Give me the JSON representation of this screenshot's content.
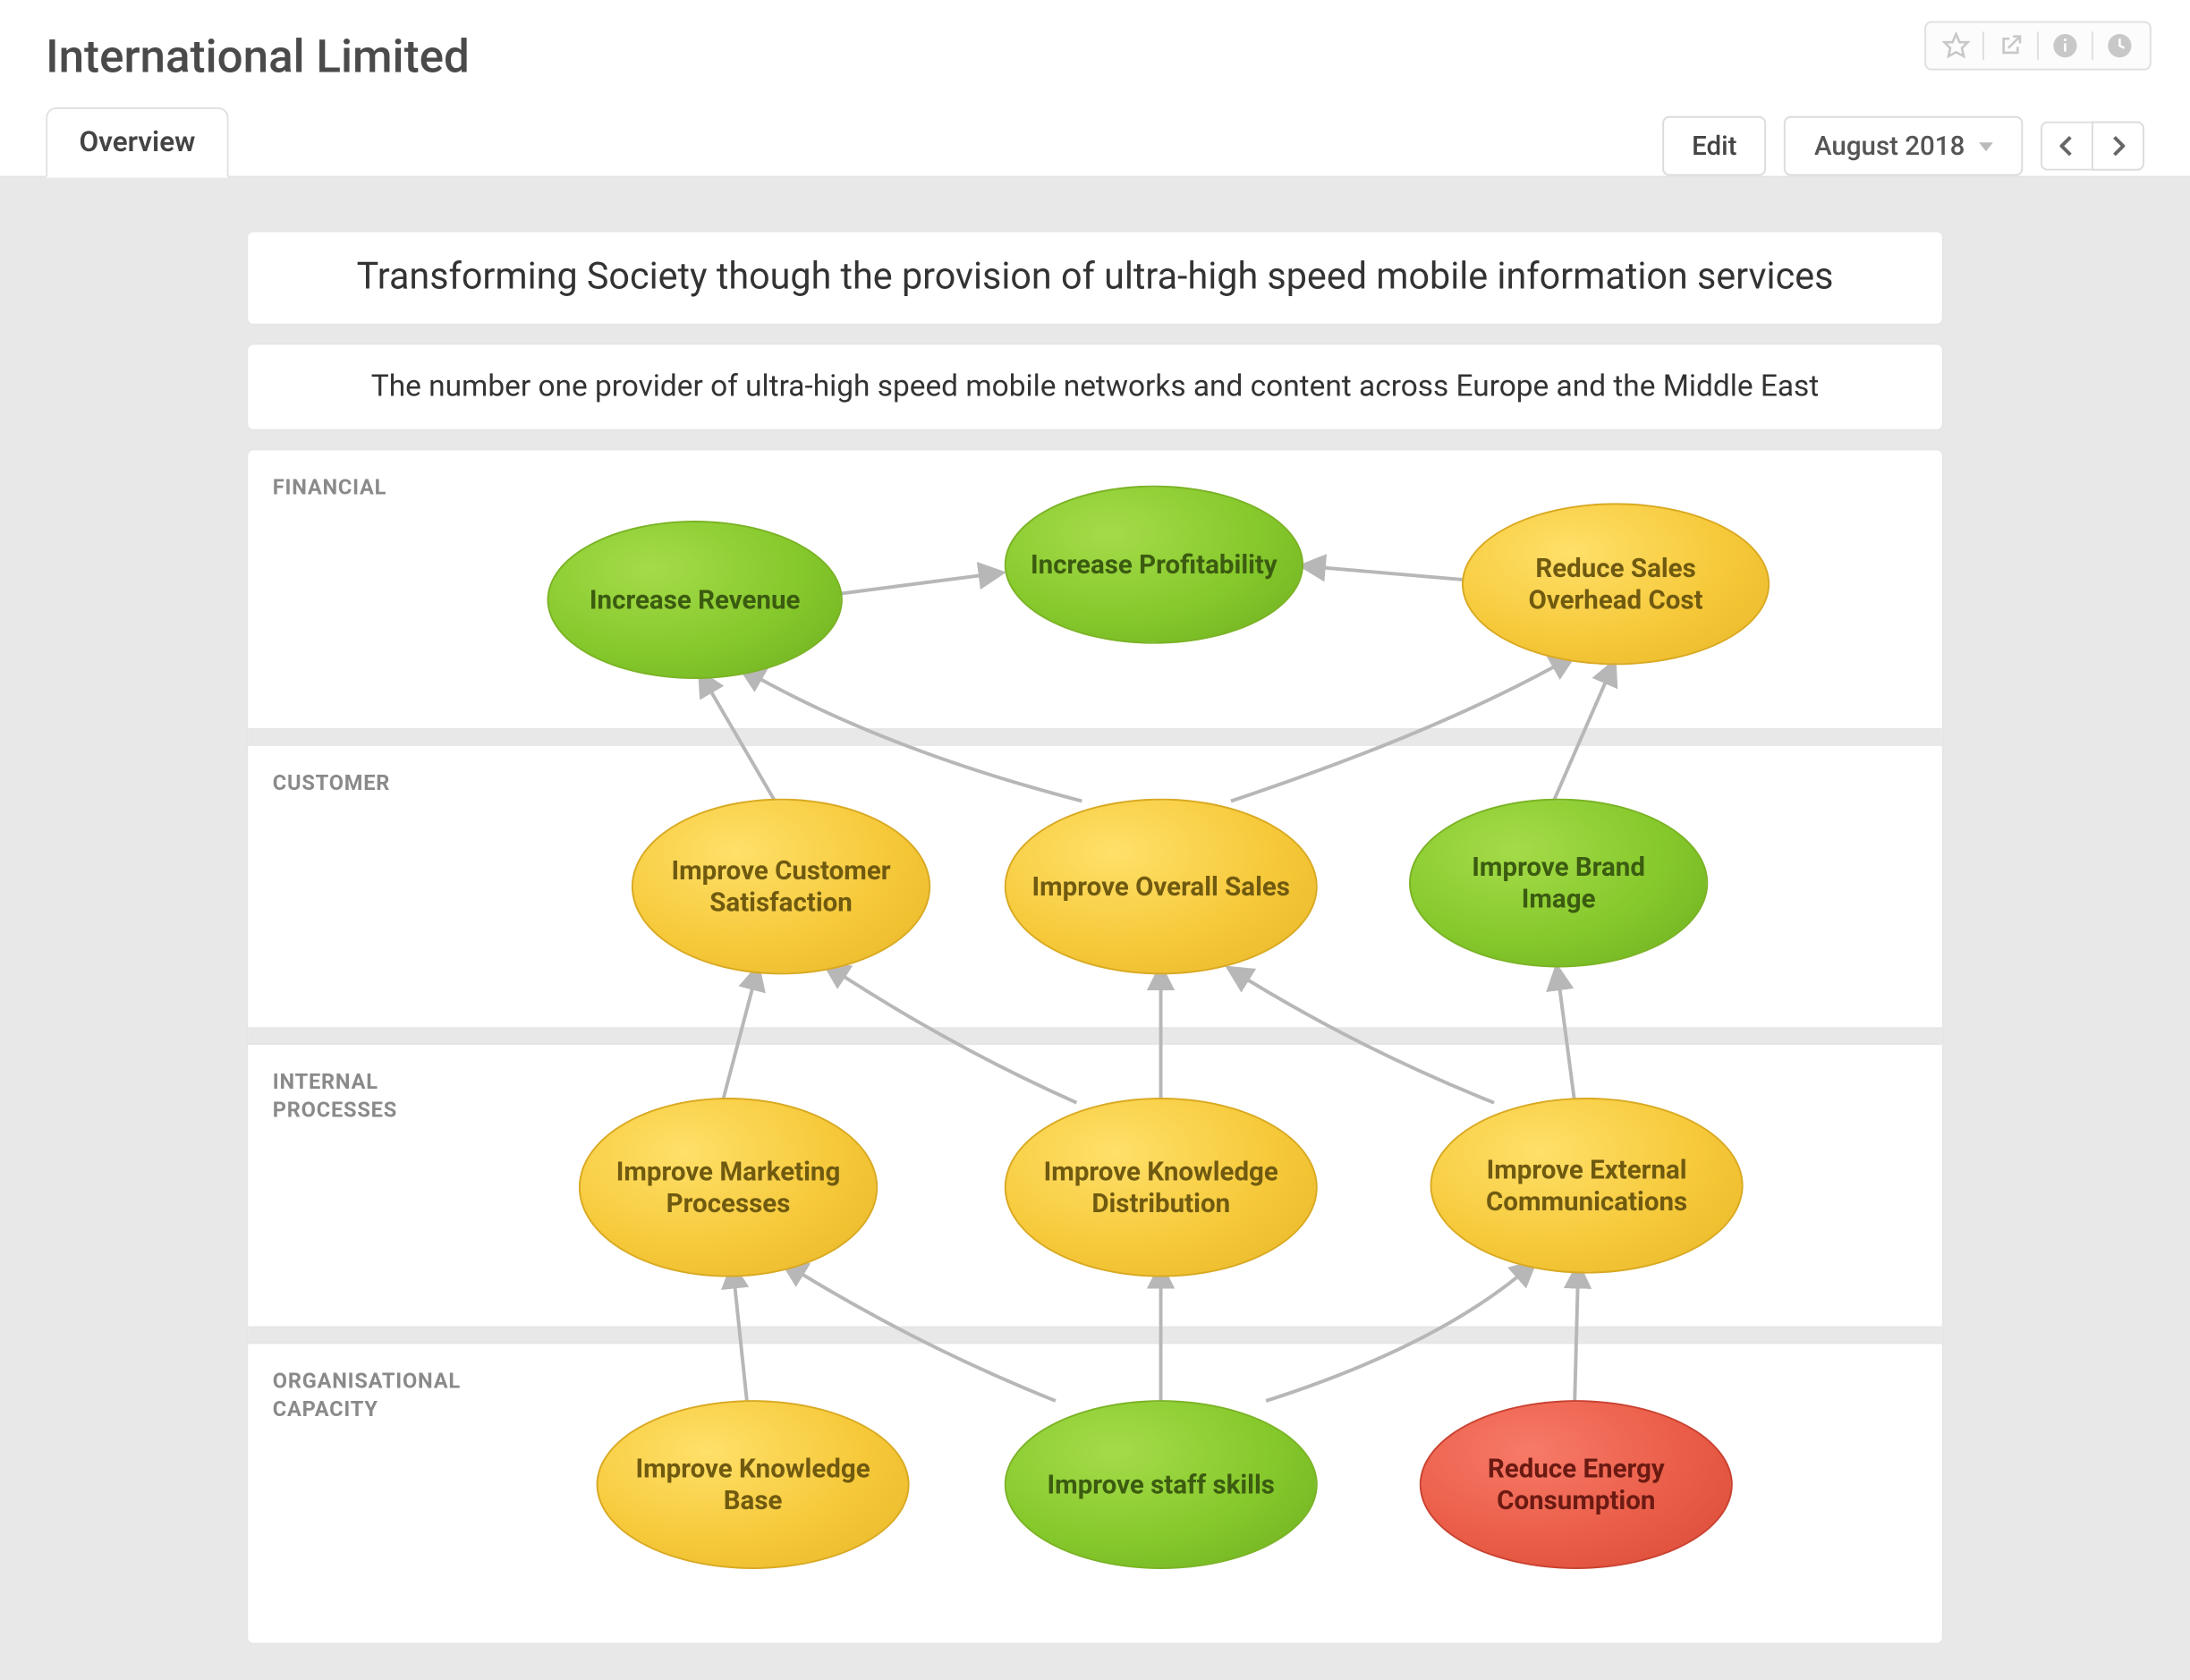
{
  "header": {
    "title": "International Limited",
    "tab_label": "Overview",
    "edit_label": "Edit",
    "period_label": "August 2018"
  },
  "mission": "Transforming Society though the provision of ultra-high speed mobile information services",
  "vision": "The number one provider of ultra-high speed mobile networks and content across Europe and the Middle East",
  "sections": {
    "financial": "FINANCIAL",
    "customer": "CUSTOMER",
    "internal": "INTERNAL PROCESSES",
    "organisational": "ORGANISATIONAL CAPACITY"
  },
  "nodes": {
    "increase_revenue": {
      "label": "Increase Revenue",
      "color": "green",
      "section": "financial"
    },
    "increase_profitability": {
      "label": "Increase Profitability",
      "color": "green",
      "section": "financial"
    },
    "reduce_overhead": {
      "label": "Reduce Sales Overhead Cost",
      "color": "yellow",
      "section": "financial"
    },
    "improve_cust_sat": {
      "label": "Improve Customer Satisfaction",
      "color": "yellow",
      "section": "customer"
    },
    "improve_sales": {
      "label": "Improve Overall Sales",
      "color": "yellow",
      "section": "customer"
    },
    "improve_brand": {
      "label": "Improve Brand Image",
      "color": "green",
      "section": "customer"
    },
    "improve_marketing": {
      "label": "Improve Marketing Processes",
      "color": "yellow",
      "section": "internal"
    },
    "improve_knowledge_dist": {
      "label": "Improve Knowledge Distribution",
      "color": "yellow",
      "section": "internal"
    },
    "improve_ext_comms": {
      "label": "Improve External Communications",
      "color": "yellow",
      "section": "internal"
    },
    "improve_kb": {
      "label": "Improve Knowledge Base",
      "color": "yellow",
      "section": "organisational"
    },
    "improve_staff": {
      "label": "Improve staff skills",
      "color": "green",
      "section": "organisational"
    },
    "reduce_energy": {
      "label": "Reduce Energy Consumption",
      "color": "red",
      "section": "organisational"
    }
  },
  "arrows": [
    {
      "from": "increase_revenue",
      "to": "increase_profitability"
    },
    {
      "from": "reduce_overhead",
      "to": "increase_profitability"
    },
    {
      "from": "improve_cust_sat",
      "to": "increase_revenue"
    },
    {
      "from": "improve_sales",
      "to": "increase_revenue"
    },
    {
      "from": "improve_sales",
      "to": "reduce_overhead"
    },
    {
      "from": "improve_brand",
      "to": "reduce_overhead"
    },
    {
      "from": "improve_marketing",
      "to": "improve_cust_sat"
    },
    {
      "from": "improve_knowledge_dist",
      "to": "improve_cust_sat"
    },
    {
      "from": "improve_knowledge_dist",
      "to": "improve_sales"
    },
    {
      "from": "improve_ext_comms",
      "to": "improve_sales"
    },
    {
      "from": "improve_ext_comms",
      "to": "improve_brand"
    },
    {
      "from": "improve_kb",
      "to": "improve_marketing"
    },
    {
      "from": "improve_staff",
      "to": "improve_marketing"
    },
    {
      "from": "improve_staff",
      "to": "improve_knowledge_dist"
    },
    {
      "from": "improve_staff",
      "to": "improve_ext_comms"
    },
    {
      "from": "reduce_energy",
      "to": "improve_ext_comms"
    }
  ]
}
